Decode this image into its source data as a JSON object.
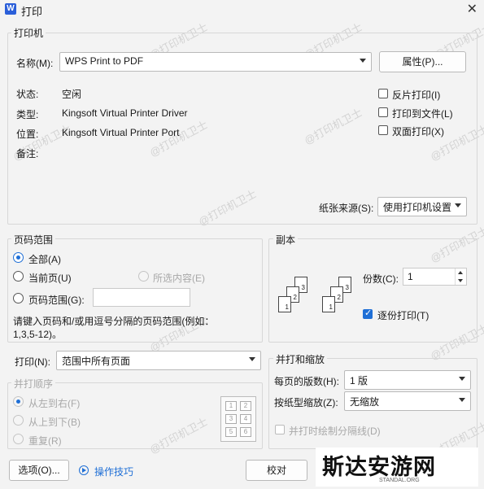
{
  "window": {
    "title": "打印",
    "app_icon": "W"
  },
  "printer": {
    "group_title": "打印机",
    "name_label": "名称(M):",
    "name_value": "WPS Print to PDF",
    "properties_button": "属性(P)...",
    "status_label": "状态:",
    "status_value": "空闲",
    "type_label": "类型:",
    "type_value": "Kingsoft Virtual Printer Driver",
    "location_label": "位置:",
    "location_value": "Kingsoft Virtual Printer Port",
    "comment_label": "备注:",
    "reverse_print": "反片打印(I)",
    "print_to_file": "打印到文件(L)",
    "duplex": "双面打印(X)",
    "paper_source_label": "纸张来源(S):",
    "paper_source_value": "使用打印机设置"
  },
  "page_range": {
    "group_title": "页码范围",
    "all": "全部(A)",
    "current": "当前页(U)",
    "selection": "所选内容(E)",
    "pages": "页码范围(G):",
    "pages_value": "",
    "hint_line1": "请键入页码和/或用逗号分隔的页码范围(例如：",
    "hint_line2": "1,3,5-12)。"
  },
  "copies": {
    "group_title": "副本",
    "count_label": "份数(C):",
    "count_value": "1",
    "collate": "逐份打印(T)",
    "stack_labels": [
      "1",
      "2",
      "3"
    ]
  },
  "print_what": {
    "label": "打印(N):",
    "value": "范围中所有页面"
  },
  "order": {
    "group_title": "并打顺序",
    "left_right": "从左到右(F)",
    "top_bottom": "从上到下(B)",
    "repeat": "重复(R)",
    "grid": [
      "1",
      "2",
      "3",
      "4",
      "5",
      "6"
    ]
  },
  "zoom": {
    "group_title": "并打和缩放",
    "pages_per_sheet_label": "每页的版数(H):",
    "pages_per_sheet_value": "1 版",
    "scale_label": "按纸型缩放(Z):",
    "scale_value": "无缩放",
    "draw_borders": "并打时绘制分隔线(D)"
  },
  "footer": {
    "options_button": "选项(O)...",
    "tips_link": "操作技巧",
    "proofread_button": "校对"
  },
  "watermark": {
    "text": "@打印机卫士"
  },
  "logo": {
    "text": "斯达安游网",
    "sub": "STANDAL.ORG"
  }
}
